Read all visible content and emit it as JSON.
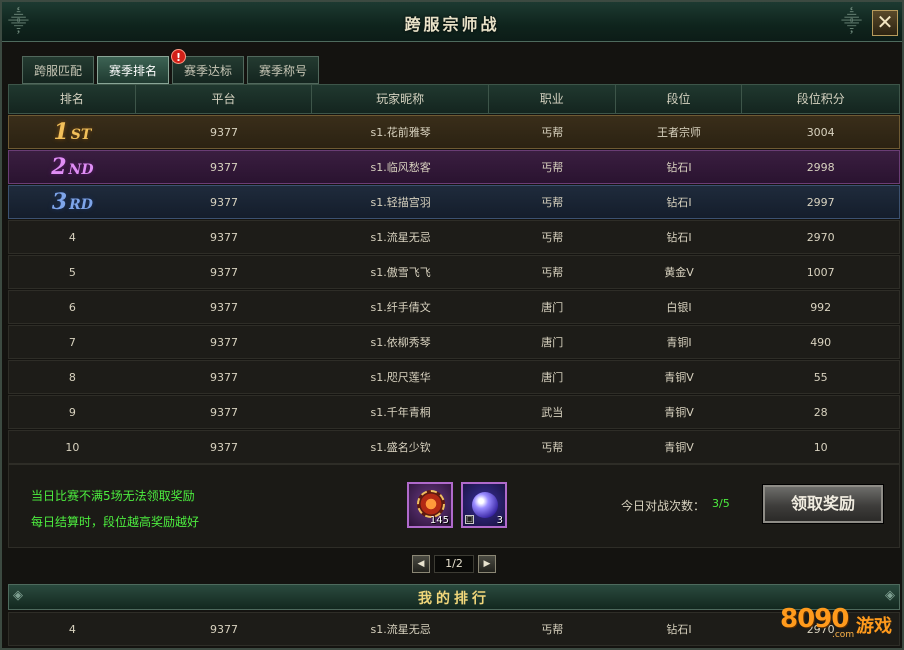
{
  "window": {
    "title": "跨服宗师战",
    "close_icon": "✕"
  },
  "tabs": [
    {
      "label": "跨服匹配",
      "active": false
    },
    {
      "label": "赛季排名",
      "active": true
    },
    {
      "label": "赛季达标",
      "active": false,
      "alert": "!"
    },
    {
      "label": "赛季称号",
      "active": false
    }
  ],
  "table": {
    "headers": [
      "排名",
      "平台",
      "玩家昵称",
      "职业",
      "段位",
      "段位积分"
    ],
    "medals": [
      {
        "num": "1",
        "suffix": "ST"
      },
      {
        "num": "2",
        "suffix": "ND"
      },
      {
        "num": "3",
        "suffix": "RD"
      }
    ],
    "rows": [
      {
        "rank": "1",
        "platform": "9377",
        "name": "s1.花前雅琴",
        "job": "丐帮",
        "tier": "王者宗师",
        "score": "3004"
      },
      {
        "rank": "2",
        "platform": "9377",
        "name": "s1.临风愁客",
        "job": "丐帮",
        "tier": "钻石I",
        "score": "2998"
      },
      {
        "rank": "3",
        "platform": "9377",
        "name": "s1.轻描宫羽",
        "job": "丐帮",
        "tier": "钻石I",
        "score": "2997"
      },
      {
        "rank": "4",
        "platform": "9377",
        "name": "s1.流星无忌",
        "job": "丐帮",
        "tier": "钻石I",
        "score": "2970"
      },
      {
        "rank": "5",
        "platform": "9377",
        "name": "s1.傲雪飞飞",
        "job": "丐帮",
        "tier": "黄金V",
        "score": "1007"
      },
      {
        "rank": "6",
        "platform": "9377",
        "name": "s1.纤手倩文",
        "job": "唐门",
        "tier": "白银I",
        "score": "992"
      },
      {
        "rank": "7",
        "platform": "9377",
        "name": "s1.依柳秀琴",
        "job": "唐门",
        "tier": "青铜I",
        "score": "490"
      },
      {
        "rank": "8",
        "platform": "9377",
        "name": "s1.咫尺莲华",
        "job": "唐门",
        "tier": "青铜V",
        "score": "55"
      },
      {
        "rank": "9",
        "platform": "9377",
        "name": "s1.千年青桐",
        "job": "武当",
        "tier": "青铜V",
        "score": "28"
      },
      {
        "rank": "10",
        "platform": "9377",
        "name": "s1.盛名少钦",
        "job": "丐帮",
        "tier": "青铜V",
        "score": "10"
      }
    ]
  },
  "info": {
    "tip1": "当日比赛不满5场无法领取奖励",
    "tip2": "每日结算时，段位越高奖励越好",
    "rewards": [
      {
        "icon": "gear-medal-icon",
        "count": "145"
      },
      {
        "icon": "purple-orb-icon",
        "count": "3",
        "bind": "□"
      }
    ],
    "battle_label": "今日对战次数：",
    "battle_value": "3/5",
    "claim_label": "领取奖励"
  },
  "pager": {
    "prev": "◀",
    "page": "1/2",
    "next": "▶"
  },
  "my_rank": {
    "title": "我的排行",
    "row": {
      "rank": "4",
      "platform": "9377",
      "name": "s1.流星无忌",
      "job": "丐帮",
      "tier": "钻石I",
      "score": "2970"
    }
  },
  "watermark": {
    "text": "8090",
    "sub": ".com",
    "cn": "游戏"
  },
  "colors": {
    "king": "#ff5a3c",
    "diamond": "#f6e84e",
    "gold": "#3fb2ff",
    "silver": "#3cf05a",
    "bronze": "#e8e2cf",
    "score": "#f5e36a",
    "tip": "#4dee3f"
  }
}
